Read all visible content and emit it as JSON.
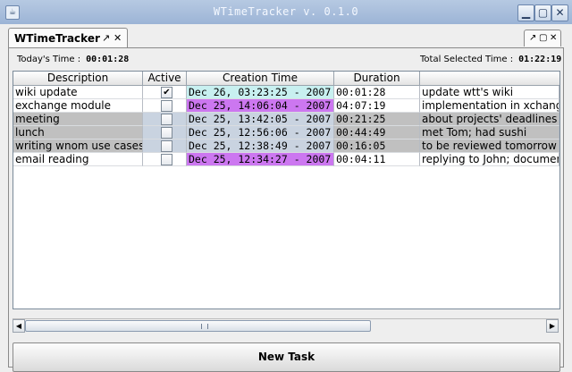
{
  "window": {
    "title": "WTimeTracker v. 0.1.0"
  },
  "tab": {
    "label": "WTimeTracker"
  },
  "stats": {
    "today_label": "Today's Time :",
    "today_value": "00:01:28",
    "selected_label": "Total Selected Time :",
    "selected_value": "01:22:19"
  },
  "table": {
    "columns": [
      "Description",
      "Active",
      "Creation Time",
      "Duration",
      ""
    ],
    "rows": [
      {
        "description": "wiki update",
        "active": true,
        "creation": "Dec 26, 03:23:25 - 2007",
        "duration": "00:01:28",
        "comment": "update wtt's wiki"
      },
      {
        "description": "exchange module",
        "active": false,
        "creation": "Dec 25, 14:06:04 - 2007",
        "duration": "04:07:19",
        "comment": "implementation in xchange"
      },
      {
        "description": "meeting",
        "active": false,
        "creation": "Dec 25, 13:42:05 - 2007",
        "duration": "00:21:25",
        "comment": "about projects' deadlines"
      },
      {
        "description": "lunch",
        "active": false,
        "creation": "Dec 25, 12:56:06 - 2007",
        "duration": "00:44:49",
        "comment": "met Tom; had sushi"
      },
      {
        "description": "writing wnom use cases",
        "active": false,
        "creation": "Dec 25, 12:38:49 - 2007",
        "duration": "00:16:05",
        "comment": "to be reviewed tomorrow"
      },
      {
        "description": "email reading",
        "active": false,
        "creation": "Dec 25, 12:34:27 - 2007",
        "duration": "00:04:11",
        "comment": "replying to John; documents"
      }
    ]
  },
  "buttons": {
    "new_task": "New Task"
  },
  "colors": {
    "accent": "#9cb4d6",
    "today_creation": "#c8f0f0",
    "highlight_creation": "#cc77f0",
    "selected_row": "#c0c0c0"
  }
}
